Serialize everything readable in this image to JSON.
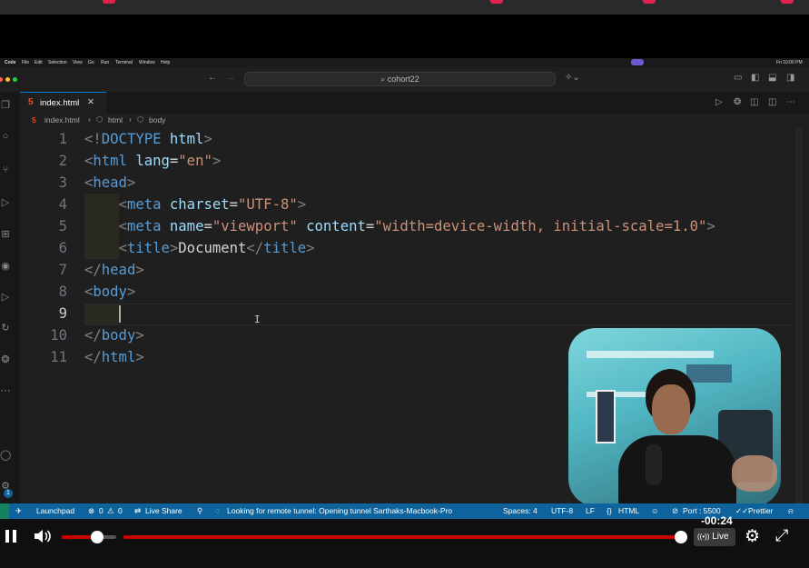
{
  "menubar": {
    "app": "Code",
    "items": [
      "File",
      "Edit",
      "Selection",
      "View",
      "Go",
      "Run",
      "Terminal",
      "Window",
      "Help"
    ],
    "clock": "Fri 10:00 PM"
  },
  "titlebar": {
    "search_text": "cohort22"
  },
  "tab": {
    "filename": "index.html"
  },
  "breadcrumb": {
    "file": "index.html",
    "seg1": "html",
    "seg2": "body"
  },
  "editor": {
    "line_numbers": [
      "1",
      "2",
      "3",
      "4",
      "5",
      "6",
      "7",
      "8",
      "9",
      "10",
      "11"
    ],
    "current_line": "9"
  },
  "statusbar": {
    "launchpad": "Launchpad",
    "problems": "0",
    "warnings": "0",
    "liveshare": "Live Share",
    "tunnel": "Looking for remote tunnel: Opening tunnel Sarthaks-Macbook-Pro",
    "spaces": "Spaces: 4",
    "encoding": "UTF-8",
    "eol": "LF",
    "language": "HTML",
    "port": "Port : 5500",
    "prettier": "Prettier",
    "badge": "1"
  },
  "video": {
    "time": "-00:24",
    "live_label": "Live",
    "volume_level": 0.65,
    "progress": 0.99,
    "accent": "#cc0000"
  },
  "icons": [
    "pause-icon",
    "volume-icon",
    "settings-icon",
    "fullscreen-icon",
    "files-icon",
    "search-icon",
    "source-control-icon",
    "run-debug-icon",
    "extensions-icon",
    "remote-icon",
    "testing-icon",
    "live-share-icon",
    "account-icon",
    "gear-icon",
    "html5-icon",
    "close-icon",
    "split-editor-icon",
    "play-icon"
  ]
}
